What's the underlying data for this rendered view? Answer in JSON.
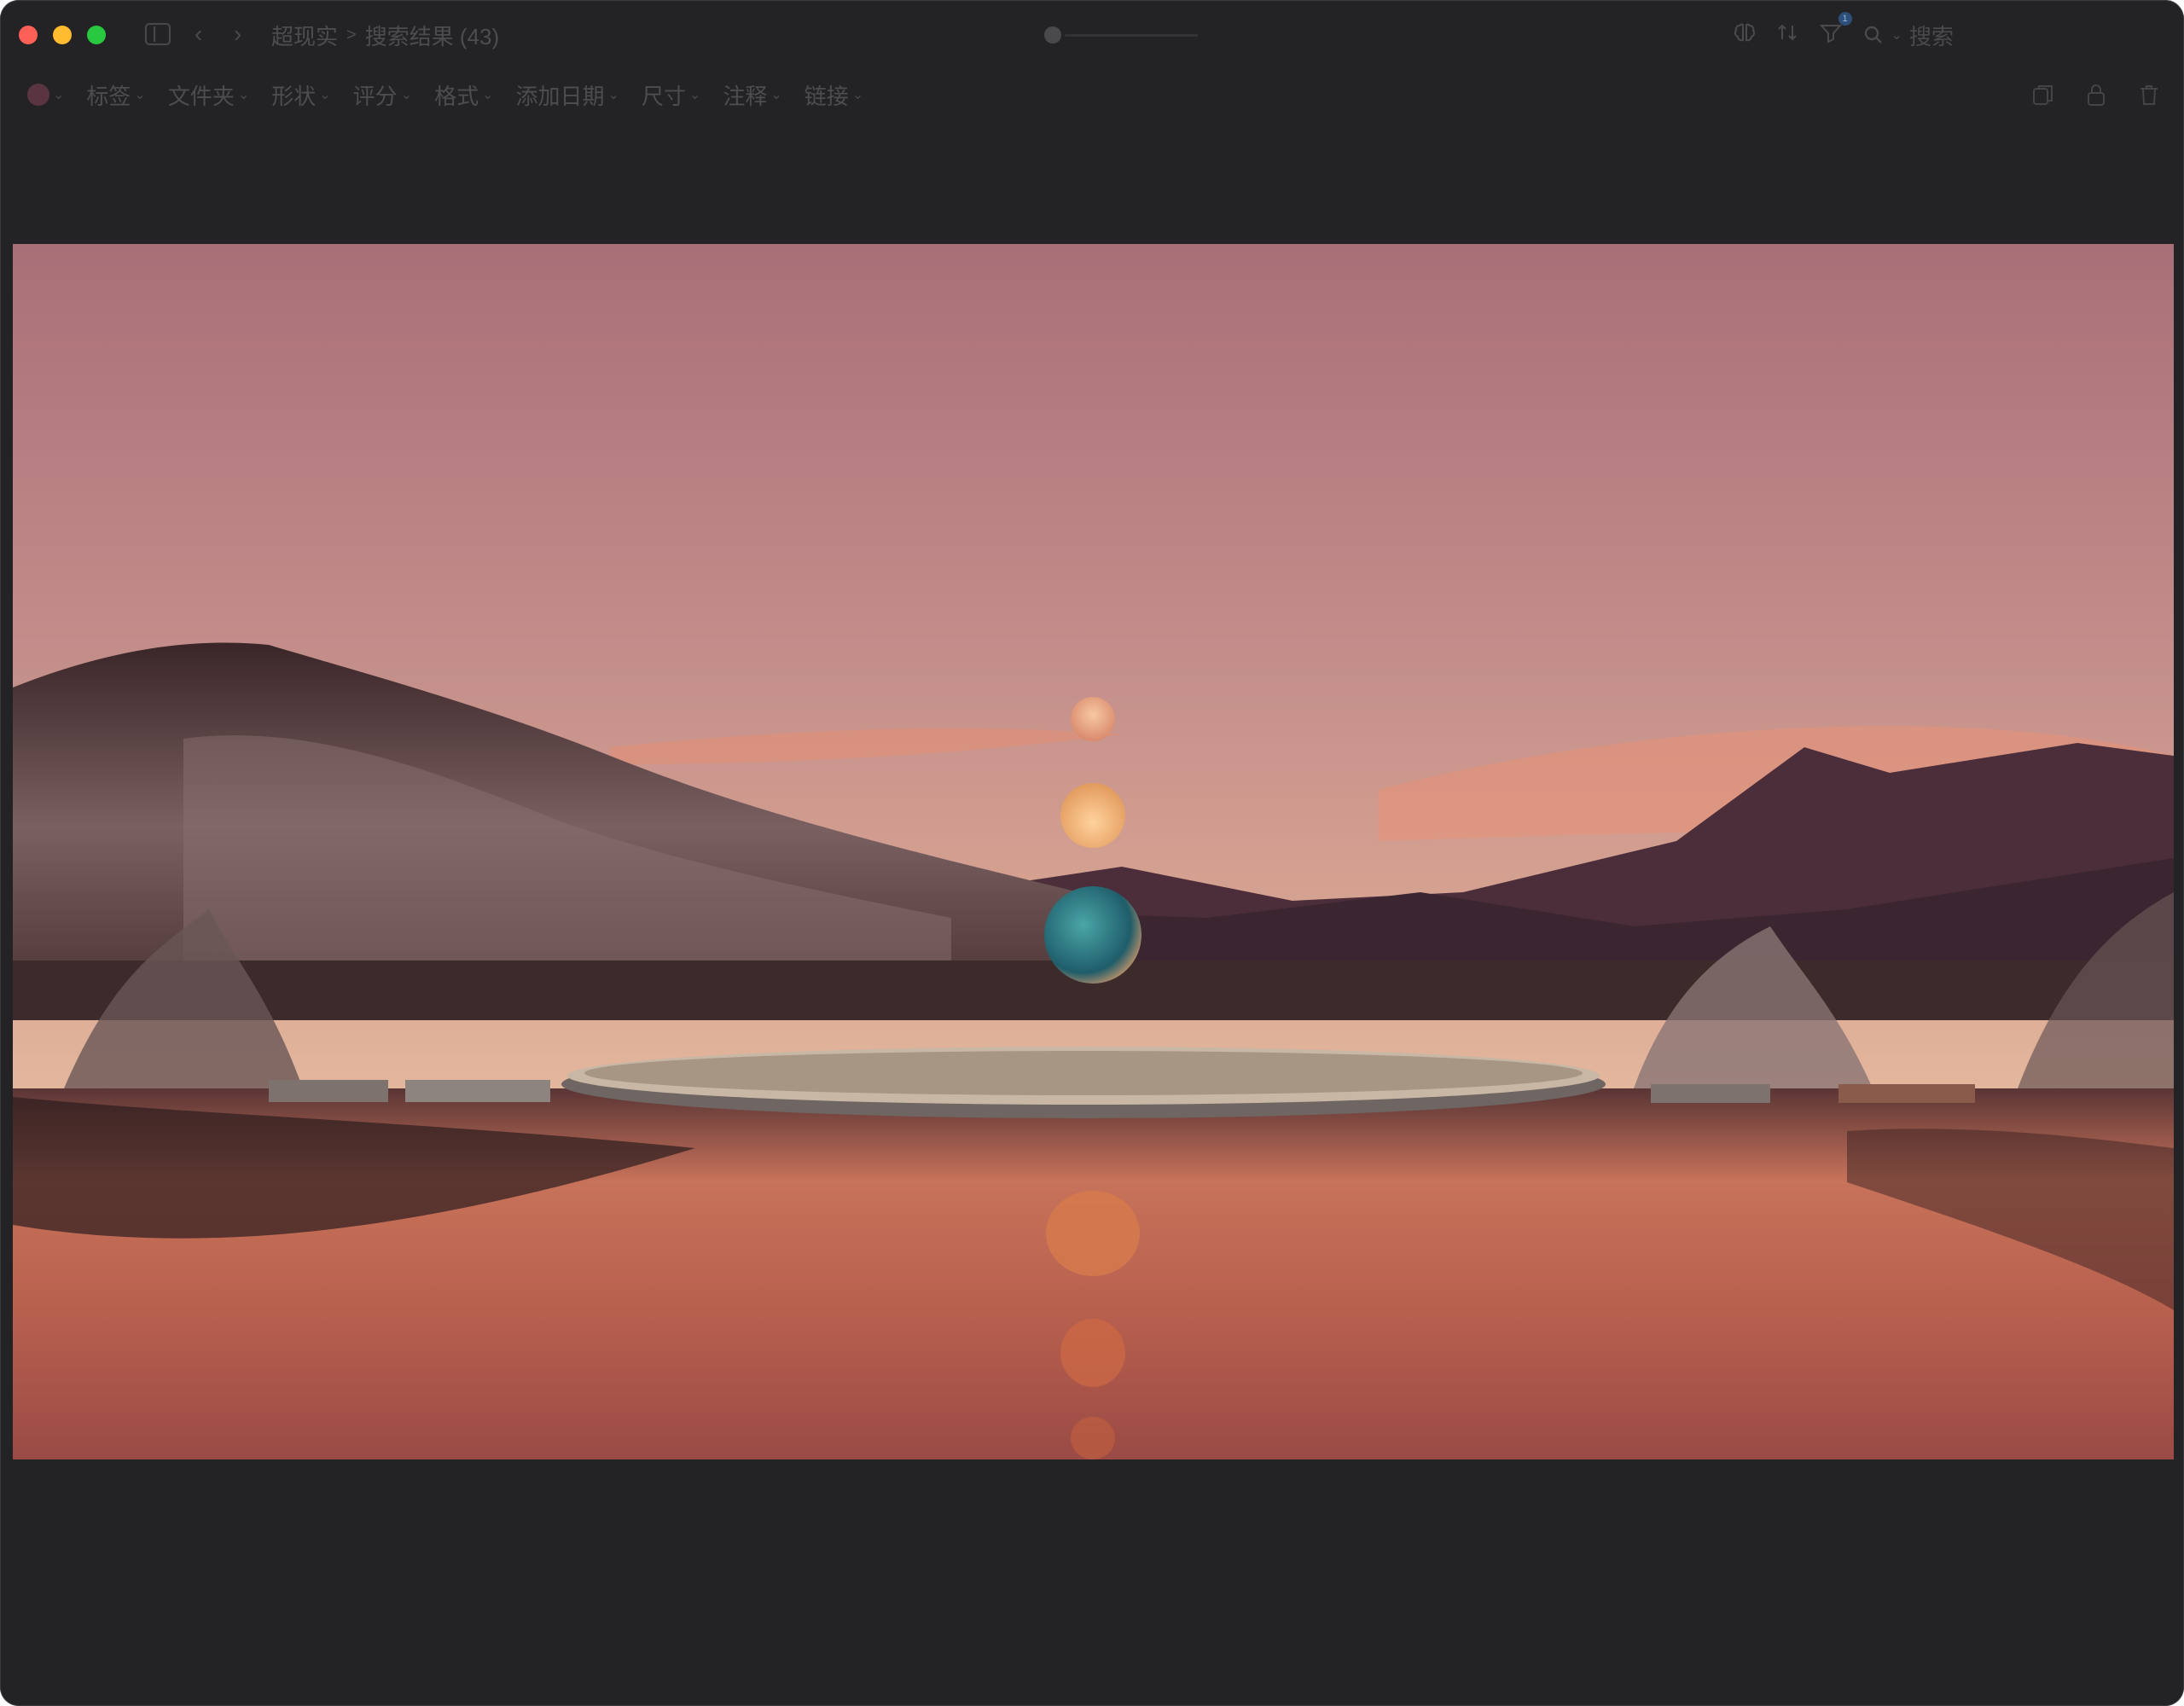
{
  "window": {
    "breadcrumb": {
      "parent": "超现实",
      "separator": ">",
      "current": "搜索结果 (43)"
    },
    "search": {
      "placeholder": "搜索"
    },
    "filter_badge_count": "1"
  },
  "filters": [
    {
      "label": "标签"
    },
    {
      "label": "文件夹"
    },
    {
      "label": "形状"
    },
    {
      "label": "评分"
    },
    {
      "label": "格式"
    },
    {
      "label": "添加日期"
    },
    {
      "label": "尺寸"
    },
    {
      "label": "注释"
    },
    {
      "label": "链接"
    }
  ],
  "colors": {
    "window_bg": "#232325",
    "close": "#fe5f57",
    "minimize": "#febc2e",
    "maximize": "#28c840"
  },
  "icons": {
    "sidebar": "sidebar-toggle-icon",
    "back": "chevron-left-icon",
    "forward": "chevron-right-icon",
    "inspector": "brain-icon",
    "sort": "sort-icon",
    "filter": "filter-icon",
    "search": "search-icon",
    "copy": "copy-icon",
    "lock": "lock-icon",
    "trash": "trash-icon"
  }
}
